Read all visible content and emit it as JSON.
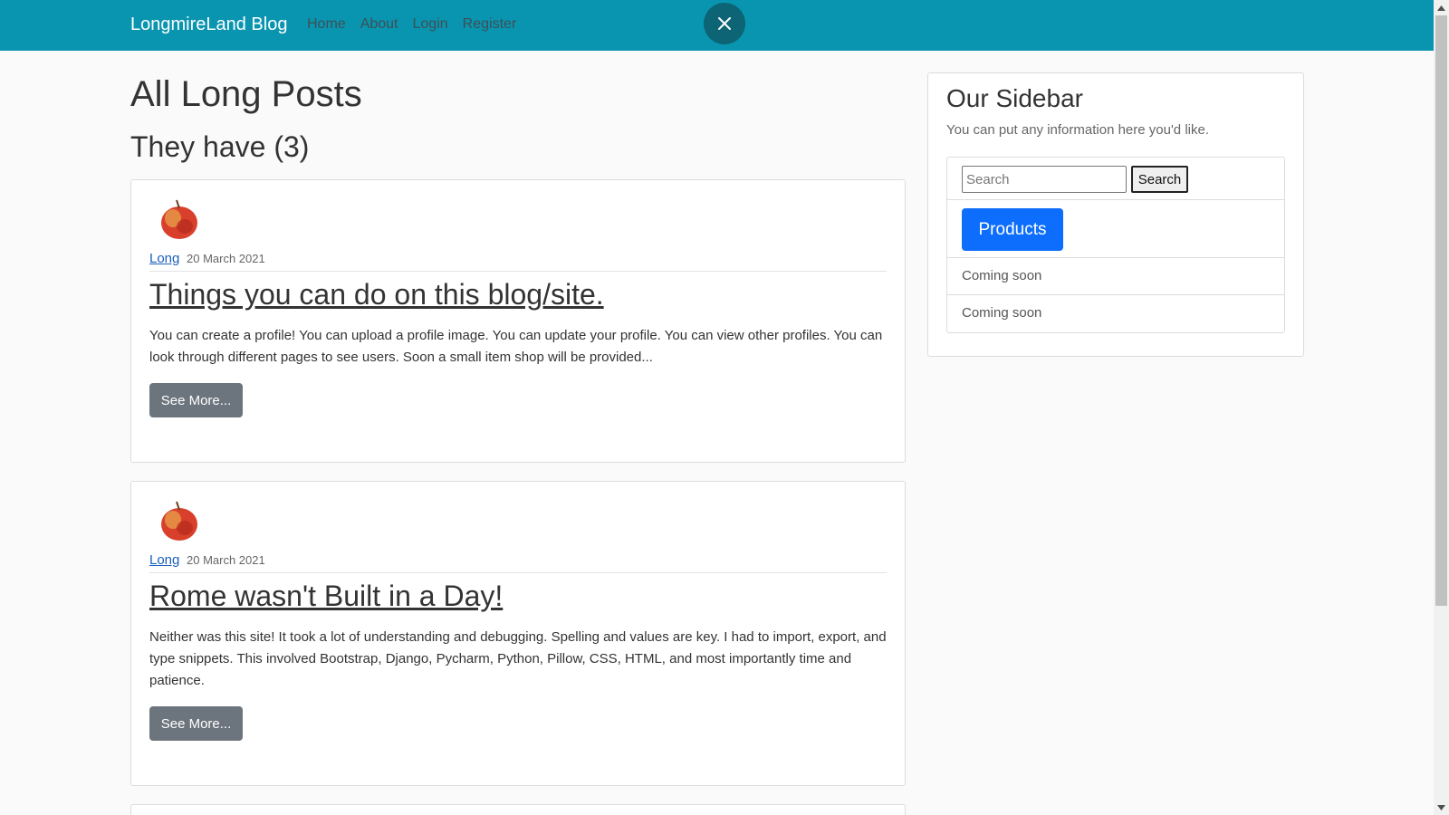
{
  "navbar": {
    "brand": "LongmireLand Blog",
    "links": [
      "Home",
      "About",
      "Login",
      "Register"
    ],
    "bg_color": "#0995b0"
  },
  "main": {
    "title": "All Long Posts",
    "subtitle": "They have (3)",
    "posts": [
      {
        "author": "Long",
        "date": "20 March 2021",
        "title": "Things you can do on this blog/site.",
        "body": "You can create a profile! You can upload a profile image. You can update your profile. You can view other profiles. You can look through different pages to see users. Soon a small item shop will be provided...",
        "button": "See More..."
      },
      {
        "author": "Long",
        "date": "20 March 2021",
        "title": "Rome wasn't Built in a Day!",
        "body": "Neither was this site! It took a lot of understanding and debugging. Spelling and values are key. I had to import, export, and type snippets. This involved Bootstrap, Django, Pycharm, Python, Pillow, CSS, HTML, and most importantly time and patience.",
        "button": "See More..."
      }
    ]
  },
  "sidebar": {
    "title": "Our Sidebar",
    "text": "You can put any information here you'd like.",
    "search": {
      "placeholder": "Search",
      "button": "Search"
    },
    "products_button": "Products",
    "items": [
      "Coming soon",
      "Coming soon"
    ]
  },
  "icons": {
    "close": "close-icon",
    "avatar": "apple-avatar-icon"
  }
}
